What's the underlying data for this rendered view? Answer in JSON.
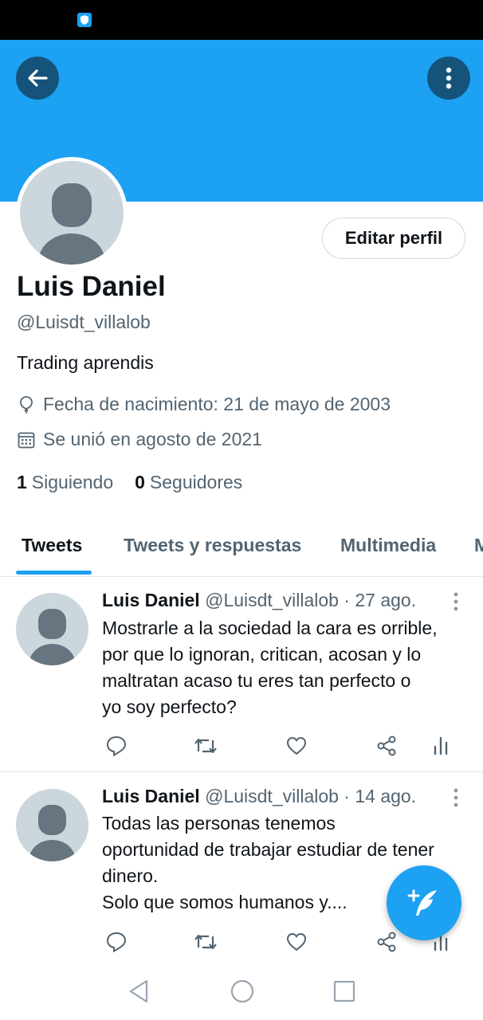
{
  "profile": {
    "name": "Luis Daniel",
    "handle": "@Luisdt_villalob",
    "bio": "Trading aprendis",
    "birthday": "Fecha de nacimiento: 21 de mayo de 2003",
    "joined": "Se unió en agosto de 2021",
    "following_count": "1",
    "following_label": "Siguiendo",
    "followers_count": "0",
    "followers_label": "Seguidores",
    "edit_button": "Editar perfil"
  },
  "tabs": [
    {
      "label": "Tweets",
      "active": true
    },
    {
      "label": "Tweets y respuestas"
    },
    {
      "label": "Multimedia"
    },
    {
      "label": "M"
    }
  ],
  "tweets": [
    {
      "name": "Luis Daniel",
      "handle_date": "@Luisdt_villalob · 27 ago.",
      "text": "Mostrarle a la sociedad la cara es orrible,\npor que lo ignoran, critican, acosan y lo\nmaltratan acaso tu eres tan perfecto o\nyo soy perfecto?"
    },
    {
      "name": "Luis Daniel",
      "handle_date": "@Luisdt_villalob · 14 ago.",
      "text": "Todas las personas tenemos\noportunidad de trabajar estudiar de tener\ndinero.\nSolo que somos humanos y...."
    }
  ],
  "icons": {
    "back": "arrow-left-icon",
    "more": "vertical-dots-icon",
    "compose": "compose-tweet-icon"
  },
  "colors": {
    "accent": "#1da1f2",
    "text": "#0f1419",
    "secondary": "#536471"
  }
}
